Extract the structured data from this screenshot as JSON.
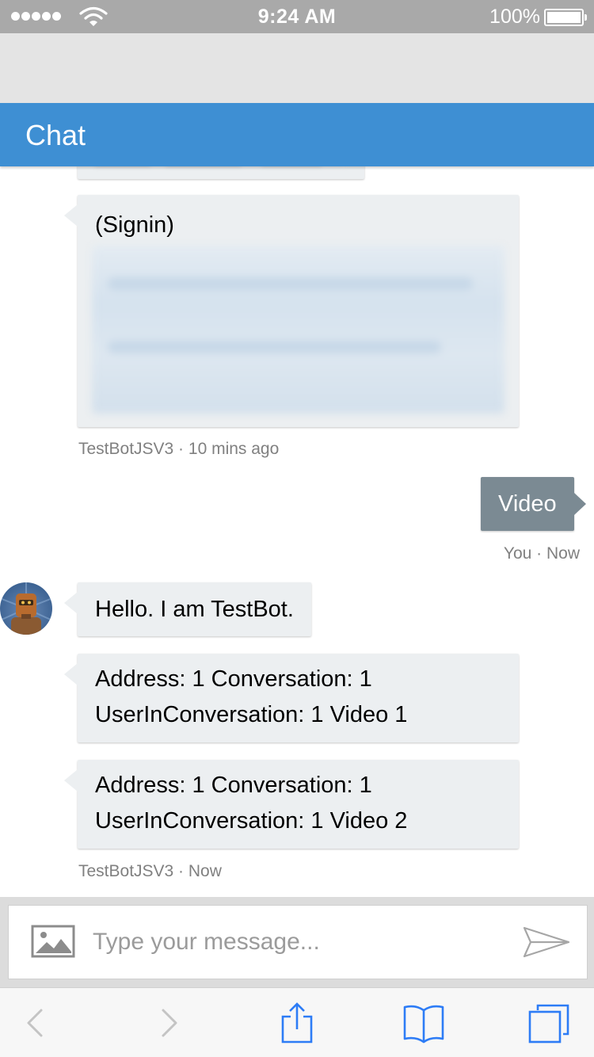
{
  "status_bar": {
    "time": "9:24 AM",
    "battery_percent": "100%",
    "signal_bars": 5,
    "icons": [
      "signal-dots-icon",
      "wifi-icon",
      "battery-icon"
    ]
  },
  "chat": {
    "title": "Chat",
    "accent_color": "#3e8fd3",
    "messages": [
      {
        "from": "bot",
        "type": "card",
        "title": "(Signin)",
        "content_obscured": true
      },
      {
        "from": "bot",
        "meta": "TestBotJSV3 · 10 mins ago"
      },
      {
        "from": "user",
        "text": "Video",
        "meta": "You · Now"
      },
      {
        "from": "bot",
        "text": "Hello. I am TestBot."
      },
      {
        "from": "bot",
        "lines": [
          "Address: 1 Conversation: 1",
          "UserInConversation: 1 Video 1"
        ]
      },
      {
        "from": "bot",
        "lines": [
          "Address: 1 Conversation: 1",
          "UserInConversation: 1 Video 2"
        ]
      },
      {
        "from": "bot",
        "meta": "TestBotJSV3 · Now"
      }
    ],
    "signin_card_title": "(Signin)",
    "meta_bot_earlier": "TestBotJSV3 · 10 mins ago",
    "user_message": "Video",
    "meta_user": "You · Now",
    "bot_greeting": "Hello. I am TestBot.",
    "bot_video_1_line1": "Address: 1 Conversation: 1",
    "bot_video_1_line2": "UserInConversation: 1 Video 1",
    "bot_video_2_line1": "Address: 1 Conversation: 1",
    "bot_video_2_line2": "UserInConversation: 1 Video 2",
    "meta_bot_latest": "TestBotJSV3 · Now"
  },
  "composer": {
    "placeholder": "Type your message...",
    "icons": [
      "image-upload-icon",
      "send-icon"
    ]
  },
  "browser_toolbar": {
    "icons": [
      "back-icon",
      "forward-icon",
      "share-icon",
      "bookmarks-icon",
      "tabs-icon"
    ],
    "tint_color": "#2d7cf6"
  }
}
